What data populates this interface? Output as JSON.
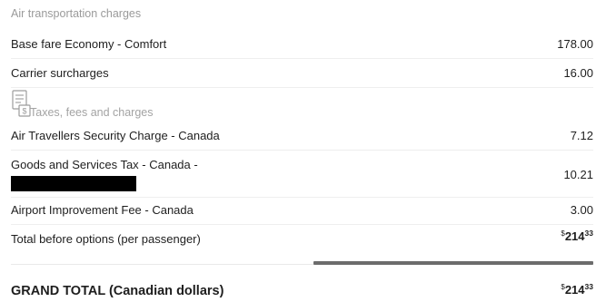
{
  "air": {
    "title": "Air transportation charges",
    "items": [
      {
        "label": "Base fare Economy - Comfort",
        "amount": "178.00"
      },
      {
        "label": "Carrier surcharges",
        "amount": "16.00"
      }
    ]
  },
  "taxes": {
    "icon": "receipt-icon",
    "title": "Taxes, fees and charges",
    "items": [
      {
        "label": "Air Travellers Security Charge - Canada",
        "amount": "7.12"
      },
      {
        "label": "Goods and Services Tax - Canada -",
        "amount": "10.21"
      },
      {
        "label": "Airport Improvement Fee - Canada",
        "amount": "3.00"
      }
    ]
  },
  "subtotal": {
    "label": "Total before options (per passenger)",
    "currency": "$",
    "whole": "214",
    "cents": "33"
  },
  "grand_total": {
    "label": "GRAND TOTAL (Canadian dollars)",
    "currency": "$",
    "whole": "214",
    "cents": "33"
  },
  "colors": {
    "text": "#1e1e1e",
    "muted": "#9a9a9a",
    "redaction": "#000000",
    "divider_dark": "#6c6c6c"
  }
}
